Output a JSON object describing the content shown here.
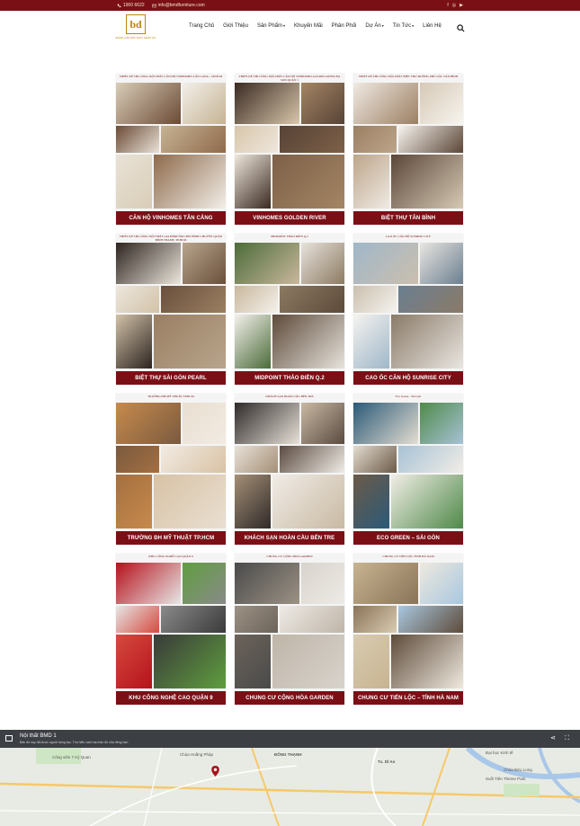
{
  "topbar": {
    "phone": "1900 6622",
    "email": "info@bmdfurniture.com",
    "social_icons": [
      "facebook-icon",
      "instagram-icon",
      "youtube-icon"
    ]
  },
  "header": {
    "logo_mark": "bd",
    "logo_tagline": "ĐẲNG CẤP NỘI THẤT CHÂU ÂU",
    "nav": [
      {
        "label": "Trang Chủ",
        "has_dropdown": false
      },
      {
        "label": "Giới Thiệu",
        "has_dropdown": false
      },
      {
        "label": "Sản Phẩm",
        "has_dropdown": true
      },
      {
        "label": "Khuyến Mãi",
        "has_dropdown": false
      },
      {
        "label": "Phân Phối",
        "has_dropdown": false
      },
      {
        "label": "Dự Án",
        "has_dropdown": true
      },
      {
        "label": "Tin Tức",
        "has_dropdown": true
      },
      {
        "label": "Liên Hệ",
        "has_dropdown": false
      }
    ]
  },
  "projects": [
    {
      "caption": "CĂN HỘ VINHOMES TÂN CẢNG",
      "overline": "THIẾT KẾ THI CÔNG NỘI THẤT CĂN HỘ VINHOMES TÂN CẢNG - TP.HCM"
    },
    {
      "caption": "VINHOMES GOLDEN RIVER",
      "overline": "THIẾT KẾ THI CÔNG NỘI THẤT CĂN HỘ VINHOMES GOLDEN RIVER BA SON QUẬN 1"
    },
    {
      "caption": "BIỆT THỰ TÂN BÌNH",
      "overline": "THIẾT KẾ THI CÔNG NỘI THẤT BIỆT THỰ ĐƯỜNG PHÚ LỘC TÂN BÌNH"
    },
    {
      "caption": "BIỆT THỰ SÀI GÒN PEARL",
      "overline": "THIẾT KẾ THI CÔNG NỘI THẤT GIA ĐÌNH ÔNG BÙI BÌNH CHUYÊN QUẬN BÌNH THẠNH, TP.HCM"
    },
    {
      "caption": "MIDPOINT THẢO ĐIỀN Q.2",
      "overline": "MIDPOINT THẢO ĐIỀN Q.2"
    },
    {
      "caption": "CAO ỐC CĂN HỘ SUNRISE CITY",
      "overline": "CAO ỐC CĂN HỘ SUNRISE CITY"
    },
    {
      "caption": "TRƯỜNG ĐH MỸ THUẬT TP.HCM",
      "overline": "TRƯỜNG ĐH MỸ THUẬT TP.HCM"
    },
    {
      "caption": "KHÁCH SẠN HOÀN CẦU BẾN TRE",
      "overline": "KHÁCH SẠN HOÀN CẦU BẾN TRE"
    },
    {
      "caption": "ECO GREEN – SÀI GÒN",
      "overline": "Eco Green - Sài Gòn"
    },
    {
      "caption": "KHU CÔNG NGHỆ CAO QUẬN 9",
      "overline": "KHU CÔNG NGHỆ CAO QUẬN 9"
    },
    {
      "caption": "CHUNG CƯ CỘNG HÒA GARDEN",
      "overline": "CHUNG CƯ CỘNG HÒA GARDEN"
    },
    {
      "caption": "CHUNG CƯ TIẾN LỘC – TỈNH HÀ NAM",
      "overline": "CHUNG CƯ TIẾN LỘC TỈNH HÀ NAM"
    }
  ],
  "map": {
    "title": "Nội thất BMD 1",
    "subtitle": "Bản đồ này đã được người dùng tạo. Tìm hiểu cách tạo bản đồ của riêng bạn.",
    "labels": [
      "Công viên 7 Kỳ Quan",
      "Chùa Hoằng Pháp",
      "ĐÔNG THẠNH",
      "Tx. Dĩ An",
      "Đại học Kinh tế",
      "Chùa Bửu Long",
      "Suối Tiên Theme Park"
    ]
  }
}
